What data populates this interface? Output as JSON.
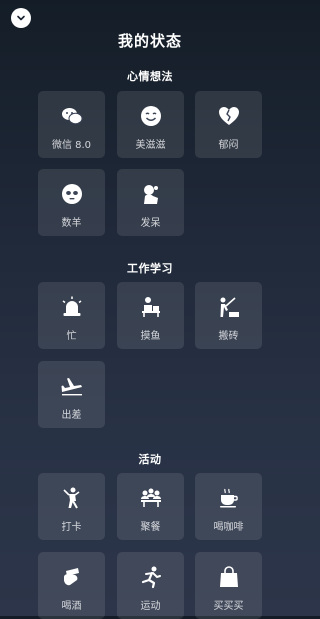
{
  "header": {
    "title": "我的状态"
  },
  "sections": [
    {
      "title": "心情想法",
      "items": [
        {
          "label": "微信 8.0",
          "icon": "wechat-icon"
        },
        {
          "label": "美滋滋",
          "icon": "smile-face-icon"
        },
        {
          "label": "郁闷",
          "icon": "broken-heart-icon"
        },
        {
          "label": "数羊",
          "icon": "sheep-face-icon"
        },
        {
          "label": "发呆",
          "icon": "daze-icon"
        }
      ]
    },
    {
      "title": "工作学习",
      "items": [
        {
          "label": "忙",
          "icon": "alarm-light-icon"
        },
        {
          "label": "摸鱼",
          "icon": "slacking-icon"
        },
        {
          "label": "搬砖",
          "icon": "brick-carrying-icon"
        },
        {
          "label": "出差",
          "icon": "airplane-icon"
        }
      ]
    },
    {
      "title": "活动",
      "items": [
        {
          "label": "打卡",
          "icon": "check-in-icon"
        },
        {
          "label": "聚餐",
          "icon": "dinner-party-icon"
        },
        {
          "label": "喝咖啡",
          "icon": "coffee-cup-icon"
        },
        {
          "label": "喝酒",
          "icon": "drinking-icon"
        },
        {
          "label": "运动",
          "icon": "running-icon"
        },
        {
          "label": "买买买",
          "icon": "shopping-bag-icon"
        }
      ]
    }
  ]
}
